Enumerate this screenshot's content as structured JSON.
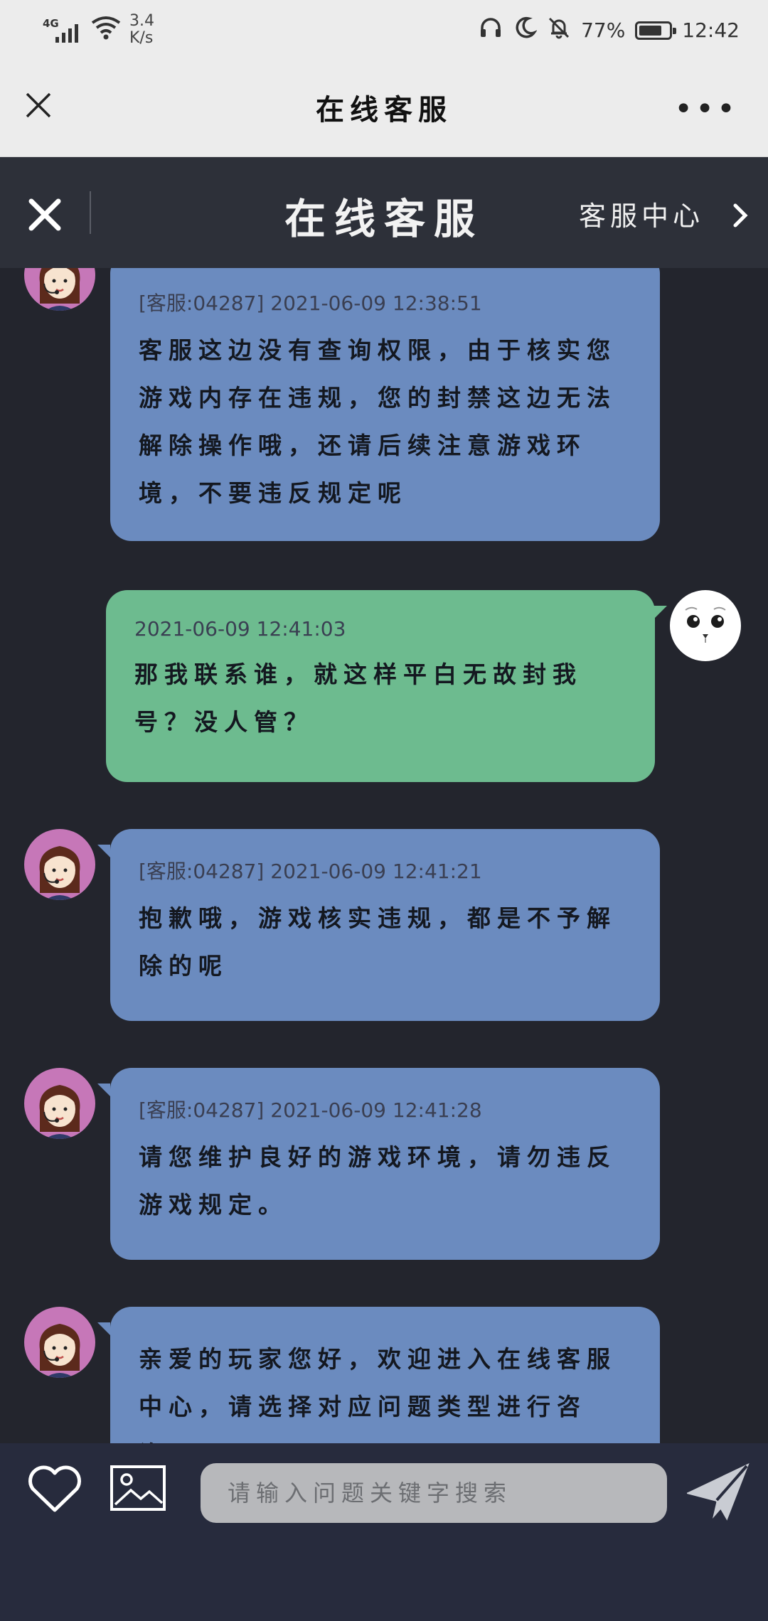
{
  "status_bar": {
    "network": "4G",
    "speed_value": "3.4",
    "speed_unit": "K/s",
    "battery": "77%",
    "battery_level": 0.77,
    "time": "12:42"
  },
  "top_nav": {
    "title": "在线客服"
  },
  "service_header": {
    "title": "在线客服",
    "center_link": "客服中心"
  },
  "chat": {
    "messages": [
      {
        "sender": "agent",
        "meta": "[客服:04287] 2021-06-09 12:38:51",
        "text": "客服这边没有查询权限，由于核实您游戏内存在违规，您的封禁这边无法解除操作哦，还请后续注意游戏环境，不要违反规定呢"
      },
      {
        "sender": "user",
        "meta": "2021-06-09 12:41:03",
        "text": "那我联系谁，就这样平白无故封我号？没人管？"
      },
      {
        "sender": "agent",
        "meta": "[客服:04287] 2021-06-09 12:41:21",
        "text": "抱歉哦，游戏核实违规，都是不予解除的呢"
      },
      {
        "sender": "agent",
        "meta": "[客服:04287] 2021-06-09 12:41:28",
        "text": "请您维护良好的游戏环境，请勿违反游戏规定。"
      },
      {
        "sender": "agent",
        "meta": "",
        "text": "亲爱的玩家您好，欢迎进入在线客服中心，请选择对应问题类型进行咨询："
      }
    ]
  },
  "input_bar": {
    "placeholder": "请输入问题关键字搜索"
  },
  "icons": {
    "close": "close-icon",
    "more": "more-icon",
    "chevron": "chevron-right-icon",
    "heart": "heart-icon",
    "image": "image-icon",
    "send": "send-icon"
  },
  "colors": {
    "agent_bubble": "#6b8bbf",
    "user_bubble": "#6dbb8f",
    "chat_bg": "#23252d",
    "header_bg": "#2d3039",
    "input_bar_bg": "#272b3d"
  }
}
